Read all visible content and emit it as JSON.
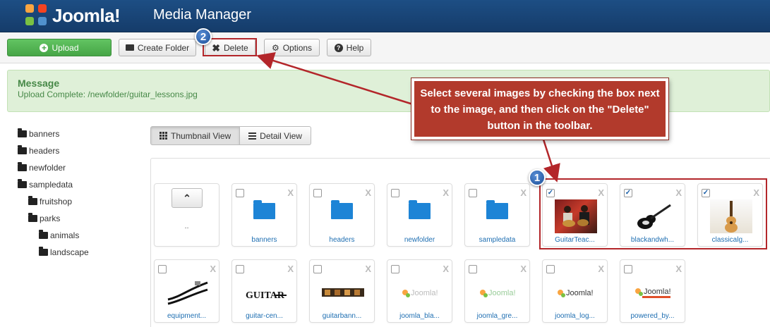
{
  "header": {
    "logo_text": "Joomla!",
    "page_title": "Media Manager"
  },
  "toolbar": {
    "upload": "Upload",
    "create_folder": "Create Folder",
    "delete": "Delete",
    "options": "Options",
    "help": "Help"
  },
  "message": {
    "title": "Message",
    "text": "Upload Complete: /newfolder/guitar_lessons.jpg"
  },
  "folders": [
    {
      "label": "banners"
    },
    {
      "label": "headers"
    },
    {
      "label": "newfolder"
    },
    {
      "label": "sampledata"
    },
    {
      "label": "fruitshop"
    },
    {
      "label": "parks"
    },
    {
      "label": "animals"
    },
    {
      "label": "landscape"
    }
  ],
  "view_tabs": {
    "thumbnail": "Thumbnail View",
    "detail": "Detail View"
  },
  "media": {
    "up_label": "..",
    "folders": [
      "banners",
      "headers",
      "newfolder",
      "sampledata"
    ],
    "images_row1": [
      "GuitarTeac...",
      "blackandwh...",
      "classicalg..."
    ],
    "images_row2": [
      "equipment...",
      "guitar-cen...",
      "guitarbann...",
      "joomla_bla...",
      "joomla_gre...",
      "joomla_log...",
      "powered_by..."
    ]
  },
  "callout": {
    "text": "Select several images by checking the box next to the image, and then click on the \"Delete\" button in the toolbar.",
    "step1": "1",
    "step2": "2"
  },
  "colors": {
    "header_bg": "#1d4e84",
    "upload_green": "#46a546",
    "message_bg": "#dff0d8",
    "callout_red": "#b23a2c",
    "link_blue": "#1f6fb2"
  }
}
